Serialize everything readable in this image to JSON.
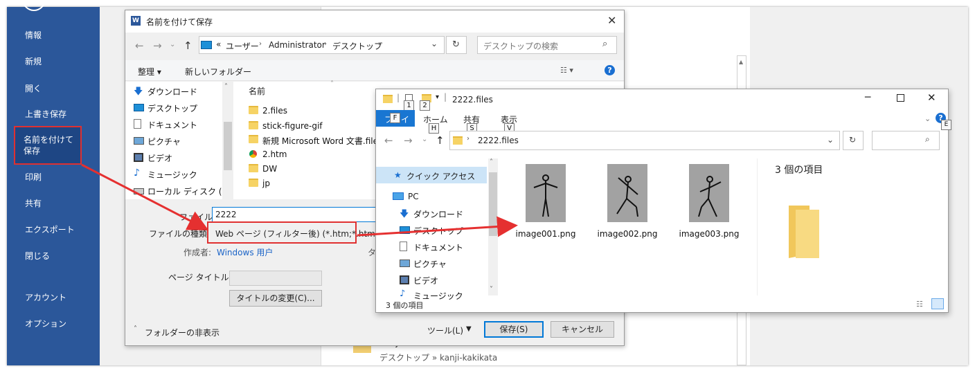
{
  "word_sidebar": {
    "items": [
      "情報",
      "新規",
      "開く",
      "上書き保存",
      "名前を付けて保存",
      "印刷",
      "共有",
      "エクスポート",
      "閉じる",
      "アカウント",
      "オプション"
    ]
  },
  "background_recent": {
    "folder_name": "kanji-kakikata",
    "folder_path": "デスクトップ » kanji-kakikata"
  },
  "save_dialog": {
    "title": "名前を付けて保存",
    "address": {
      "prefix": "«",
      "segments": [
        "ユーザー",
        "Administrator",
        "デスクトップ"
      ]
    },
    "search_placeholder": "デスクトップの検索",
    "toolbar": {
      "organize": "整理 ▾",
      "new_folder": "新しいフォルダー"
    },
    "tree": [
      "ダウンロード",
      "デスクトップ",
      "ドキュメント",
      "ピクチャ",
      "ビデオ",
      "ミュージック",
      "ローカル ディスク (C"
    ],
    "column_name": "名前",
    "files": [
      "2.files",
      "stick-figure-gif",
      "新規 Microsoft Word 文書.files",
      "2.htm",
      "DW",
      "jp"
    ],
    "filename_label": "ファイル名(N):",
    "filename_value": "2222",
    "filetype_label": "ファイルの種類(T):",
    "filetype_value": "Web ページ (フィルター後) (*.htm;*.html)",
    "author_label": "作成者:",
    "author_value": "Windows 用户",
    "tags_label": "タ",
    "page_title_label": "ページ タイトル(T):",
    "change_title_button": "タイトルの変更(C)...",
    "hide_folders": "フォルダーの非表示",
    "tools_button": "ツール(L)",
    "save_button": "保存(S)",
    "cancel_button": "キャンセル"
  },
  "explorer": {
    "title": "2222.files",
    "quick_badges": [
      "1",
      "2"
    ],
    "ribbon_tabs": [
      {
        "label": "ファイル",
        "key": "F"
      },
      {
        "label": "ホーム",
        "key": "H"
      },
      {
        "label": "共有",
        "key": "S"
      },
      {
        "label": "表示",
        "key": "V"
      }
    ],
    "address": "2222.files",
    "nav": {
      "quick_access": "クイック アクセス",
      "pc": "PC",
      "items": [
        "ダウンロード",
        "デスクトップ",
        "ドキュメント",
        "ピクチャ",
        "ビデオ",
        "ミュージック"
      ]
    },
    "files": [
      "image001.png",
      "image002.png",
      "image003.png"
    ],
    "preview_count": "3 個の項目",
    "status_count": "3 個の項目",
    "help_badge": "E"
  },
  "colors": {
    "word_blue": "#2b579a",
    "highlight_red": "#e03030",
    "accent_blue": "#0078d7"
  }
}
